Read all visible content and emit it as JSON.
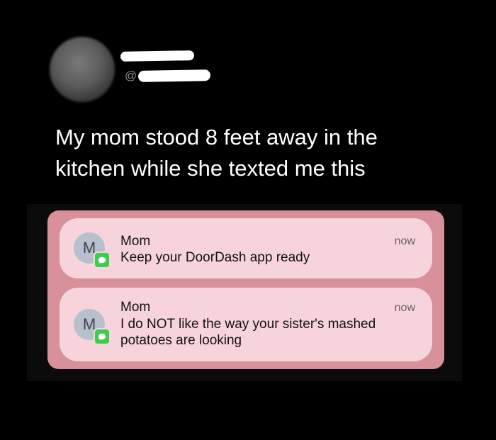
{
  "tweet": {
    "handle_prefix": "@",
    "text": "My mom stood 8 feet away in the kitchen while she texted me this"
  },
  "notifications": [
    {
      "avatar_initial": "M",
      "sender": "Mom",
      "message": "Keep your DoorDash app ready",
      "time": "now",
      "app_icon": "messages-icon"
    },
    {
      "avatar_initial": "M",
      "sender": "Mom",
      "message": "I do NOT like the way your sister's mashed potatoes are looking",
      "time": "now",
      "app_icon": "messages-icon"
    }
  ],
  "colors": {
    "background": "#000000",
    "panel": "#d8909a",
    "notification": "#f7d4dc",
    "messages_green": "#3ccd4e"
  }
}
